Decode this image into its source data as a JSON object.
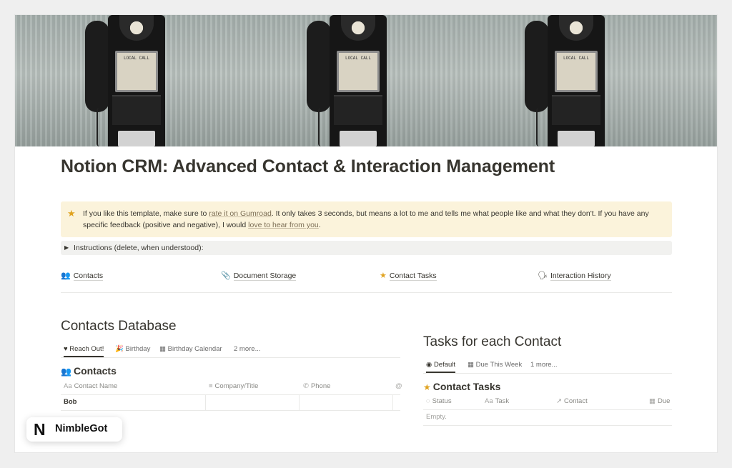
{
  "cover": {
    "phones": [
      {
        "plate_label": "LOCAL CALL"
      },
      {
        "plate_label": "LOCAL CALL"
      },
      {
        "plate_label": "LOCAL CALL"
      }
    ]
  },
  "page": {
    "title": "Notion CRM: Advanced Contact & Interaction Management"
  },
  "callout": {
    "icon": "star-icon",
    "text_before": "If you like this template, make sure to ",
    "link1": "rate it on Gumroad",
    "text_middle": ". It only takes 3 seconds, but means a lot to me and tells me what people like and what they don't. If you have any specific feedback (positive and negative), I would ",
    "link2": "love to hear from you",
    "text_after": "."
  },
  "toggle": {
    "label": "Instructions (delete, when understood):"
  },
  "links": [
    {
      "icon": "people-icon",
      "label": "Contacts"
    },
    {
      "icon": "paperclip-icon",
      "label": "Document Storage"
    },
    {
      "icon": "star-icon",
      "label": "Contact Tasks"
    },
    {
      "icon": "speech-icon",
      "label": "Interaction History"
    }
  ],
  "contacts_section": {
    "heading": "Contacts Database",
    "tabs": [
      {
        "icon": "heart-icon",
        "label": "Reach Out!",
        "active": true
      },
      {
        "icon": "party-icon",
        "label": "Birthday",
        "active": false
      },
      {
        "icon": "calendar-icon",
        "label": "Birthday Calendar",
        "active": false
      },
      {
        "icon": "",
        "label": "2 more...",
        "active": false
      }
    ],
    "db_title": "Contacts",
    "columns": [
      {
        "icon": "text-icon",
        "label": "Contact Name"
      },
      {
        "icon": "lines-icon",
        "label": "Company/Title"
      },
      {
        "icon": "phone-icon",
        "label": "Phone"
      }
    ],
    "rows": [
      {
        "name": "Bob"
      }
    ]
  },
  "tasks_section": {
    "heading": "Tasks for each Contact",
    "tabs": [
      {
        "icon": "target-icon",
        "label": "Default",
        "active": true
      },
      {
        "icon": "calendar-icon",
        "label": "Due This Week",
        "active": false
      },
      {
        "icon": "",
        "label": "1 more...",
        "active": false
      }
    ],
    "db_title": "Contact Tasks",
    "columns": [
      {
        "icon": "status-icon",
        "label": "Status"
      },
      {
        "icon": "text-icon",
        "label": "Task"
      },
      {
        "icon": "arrow-icon",
        "label": "Contact"
      },
      {
        "icon": "calendar-icon",
        "label": "Due"
      }
    ],
    "empty_text": "Empty."
  },
  "brand": {
    "logo": "N",
    "name": "NimbleGot"
  },
  "colors": {
    "callout_bg": "#fbf3db",
    "toggle_bg": "#f1f1ef",
    "text": "#37352f"
  }
}
